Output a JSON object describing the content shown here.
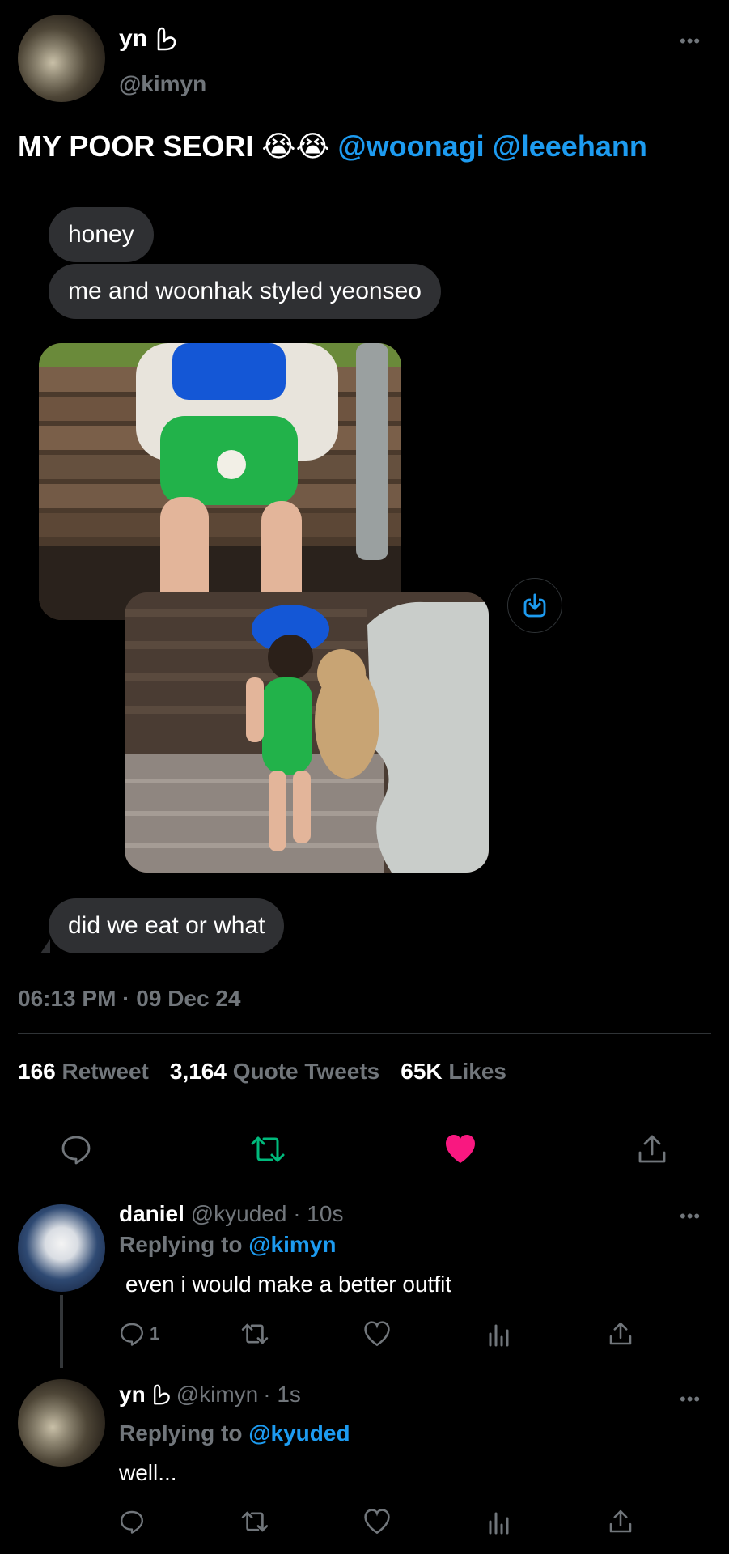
{
  "tweet": {
    "author_name": "yn",
    "author_handle": "@kimyn",
    "text_prefix": "MY POOR SEORI 😭😭",
    "mention_1": "@woonagi",
    "mention_2": "@leeehann",
    "timestamp": "06:13 PM · 09 Dec 24",
    "stats": {
      "retweets_count": "166",
      "retweets_label": "Retweet",
      "quotes_count": "3,164",
      "quotes_label": "Quote Tweets",
      "likes_count": "65K",
      "likes_label": "Likes"
    },
    "liked": true
  },
  "chat": {
    "messages_top": [
      "honey",
      "me and woonhak styled yeonseo"
    ],
    "message_bottom": "did we eat or what"
  },
  "replies": [
    {
      "name": "daniel",
      "handle": "@kyuded",
      "time": "· 10s",
      "replying_label": "Replying to",
      "replying_to": "@kimyn",
      "text": "even i would make a better outfit",
      "reply_count": "1"
    },
    {
      "name": "yn",
      "handle": "@kimyn",
      "time": "· 1s",
      "replying_label": "Replying to",
      "replying_to": "@kyuded",
      "text": "well..."
    }
  ],
  "colors": {
    "background": "#000000",
    "accent": "#1d9bf0",
    "like": "#f91880",
    "retweet": "#00ba7c",
    "muted": "#71767b",
    "bubble": "#2f3033"
  }
}
